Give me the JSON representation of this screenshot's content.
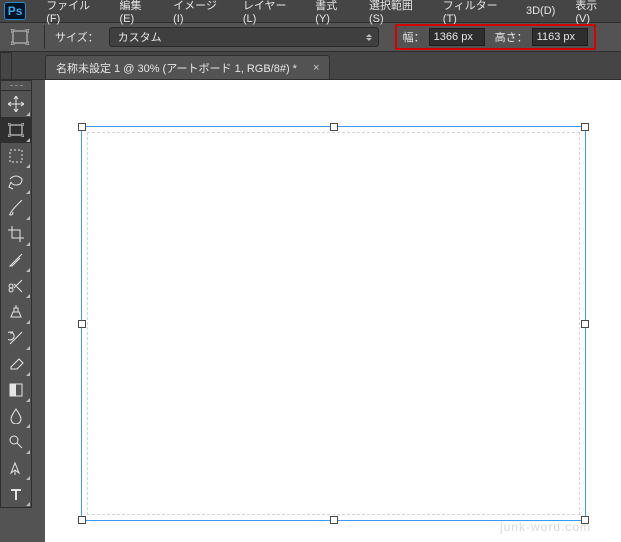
{
  "app": {
    "logo_text": "Ps"
  },
  "menu": [
    {
      "label": "ファイル(F)"
    },
    {
      "label": "編集(E)"
    },
    {
      "label": "イメージ(I)"
    },
    {
      "label": "レイヤー(L)"
    },
    {
      "label": "書式(Y)"
    },
    {
      "label": "選択範囲(S)"
    },
    {
      "label": "フィルター(T)"
    },
    {
      "label": "3D(D)"
    },
    {
      "label": "表示(V)"
    }
  ],
  "options": {
    "size_label": "サイズ：",
    "size_value": "カスタム",
    "width_label": "幅：",
    "width_value": "1366 px",
    "height_label": "高さ：",
    "height_value": "1163 px"
  },
  "tabs": [
    {
      "title": "名称未設定 1 @ 30% (アートボード 1, RGB/8#) *",
      "close": "×"
    }
  ],
  "watermark": "junk-word.com",
  "tools": [
    {
      "name": "move-tool"
    },
    {
      "name": "artboard-tool"
    },
    {
      "name": "marquee-tool"
    },
    {
      "name": "lasso-tool"
    },
    {
      "name": "brush-tool"
    },
    {
      "name": "crop-tool"
    },
    {
      "name": "eyedropper-tool"
    },
    {
      "name": "scissors-tool"
    },
    {
      "name": "clone-stamp-tool"
    },
    {
      "name": "history-brush-tool"
    },
    {
      "name": "eraser-tool"
    },
    {
      "name": "gradient-tool"
    },
    {
      "name": "blur-tool"
    },
    {
      "name": "dodge-tool"
    },
    {
      "name": "pen-tool"
    },
    {
      "name": "type-tool"
    }
  ],
  "colors": {
    "highlight": "#d40000",
    "selection": "#3f9af5",
    "ui_dark": "#535353"
  }
}
